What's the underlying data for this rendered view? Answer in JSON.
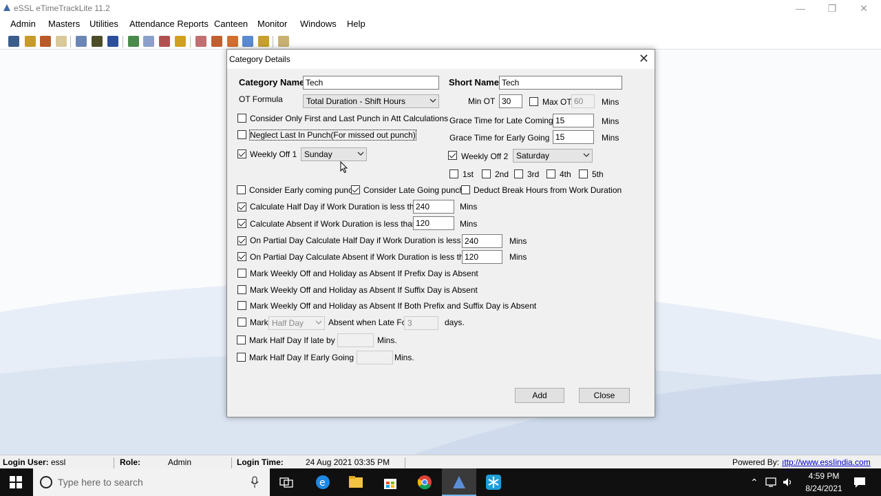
{
  "app": {
    "title": "eSSL eTimeTrackLite 11.2",
    "menu": [
      "Admin",
      "Masters",
      "Utilities",
      "Attendance Reports",
      "Canteen",
      "Monitor",
      "Windows",
      "Help"
    ],
    "toolbar_icons": [
      "employee-icon",
      "key-icon",
      "leave-icon",
      "printer-icon",
      "grid-icon",
      "users-icon",
      "book-icon",
      "upload-icon",
      "calendar-icon",
      "report-icon",
      "export-icon",
      "link-icon",
      "tools-icon",
      "settings-icon",
      "device-icon",
      "sync-icon",
      "folder-icon"
    ]
  },
  "dialog": {
    "title": "Category Details",
    "category_name_label": "Category Name",
    "category_name_value": "Tech",
    "short_name_label": "Short Name",
    "short_name_value": "Tech",
    "ot_formula_label": "OT Formula",
    "ot_formula_value": "Total Duration - Shift Hours",
    "min_ot_label": "Min OT",
    "min_ot_value": "30",
    "max_ot_label": "Max OT",
    "max_ot_value": "60",
    "mins": "Mins",
    "mins_dot": "Mins.",
    "first_last_punch": "Consider Only First and Last Punch in Att Calculations",
    "neglect_last_in": "Neglect Last In Punch(For missed out punch)",
    "grace_late_label": "Grace Time for Late Coming",
    "grace_late_value": "15",
    "grace_early_label": "Grace Time for Early Going",
    "grace_early_value": "15",
    "weekly_off1_label": "Weekly Off 1",
    "weekly_off1_value": "Sunday",
    "weekly_off2_label": "Weekly Off 2",
    "weekly_off2_value": "Saturday",
    "weeks": [
      "1st",
      "2nd",
      "3rd",
      "4th",
      "5th"
    ],
    "early_coming": "Consider Early coming punch",
    "late_going": "Consider Late Going punch",
    "deduct_break": "Deduct Break Hours from Work Duration",
    "half_day_label": "Calculate Half Day if Work Duration is less than",
    "half_day_value": "240",
    "absent_label": "Calculate Absent  if Work Duration is less than",
    "absent_value": "120",
    "partial_half_label": "On Partial Day Calculate Half Day if Work Duration is less than",
    "partial_half_value": "240",
    "partial_absent_label": "On Partial Day Calculate Absent  if Work Duration is less than",
    "partial_absent_value": "120",
    "prefix_absent": "Mark Weekly Off and Holiday as Absent If Prefix Day is Absent",
    "suffix_absent": "Mark Weekly Off and Holiday as Absent If Suffix Day is Absent",
    "both_absent": "Mark Weekly Off and Holiday as Absent If Both Prefix and Suffix Day is Absent",
    "mark_label": "Mark",
    "mark_value": "Half Day",
    "absent_when_late": "Absent when Late For",
    "late_days_value": "3",
    "days": "days.",
    "half_day_late": "Mark Half Day If late by",
    "half_day_early": "Mark Half Day If Early Going by",
    "add_button": "Add",
    "close_button": "Close"
  },
  "status": {
    "login_user_label": "Login User:",
    "login_user": "essl",
    "role_label": "Role:",
    "role": "Admin",
    "login_time_label": "Login Time:",
    "login_time": "24 Aug 2021 03:35 PM",
    "powered_by_label": "Powered By:",
    "powered_by_link": "ıttp://www.essIindia.com"
  },
  "taskbar": {
    "search_placeholder": "Type here to search",
    "time": "4:59 PM",
    "date": "8/24/2021"
  }
}
